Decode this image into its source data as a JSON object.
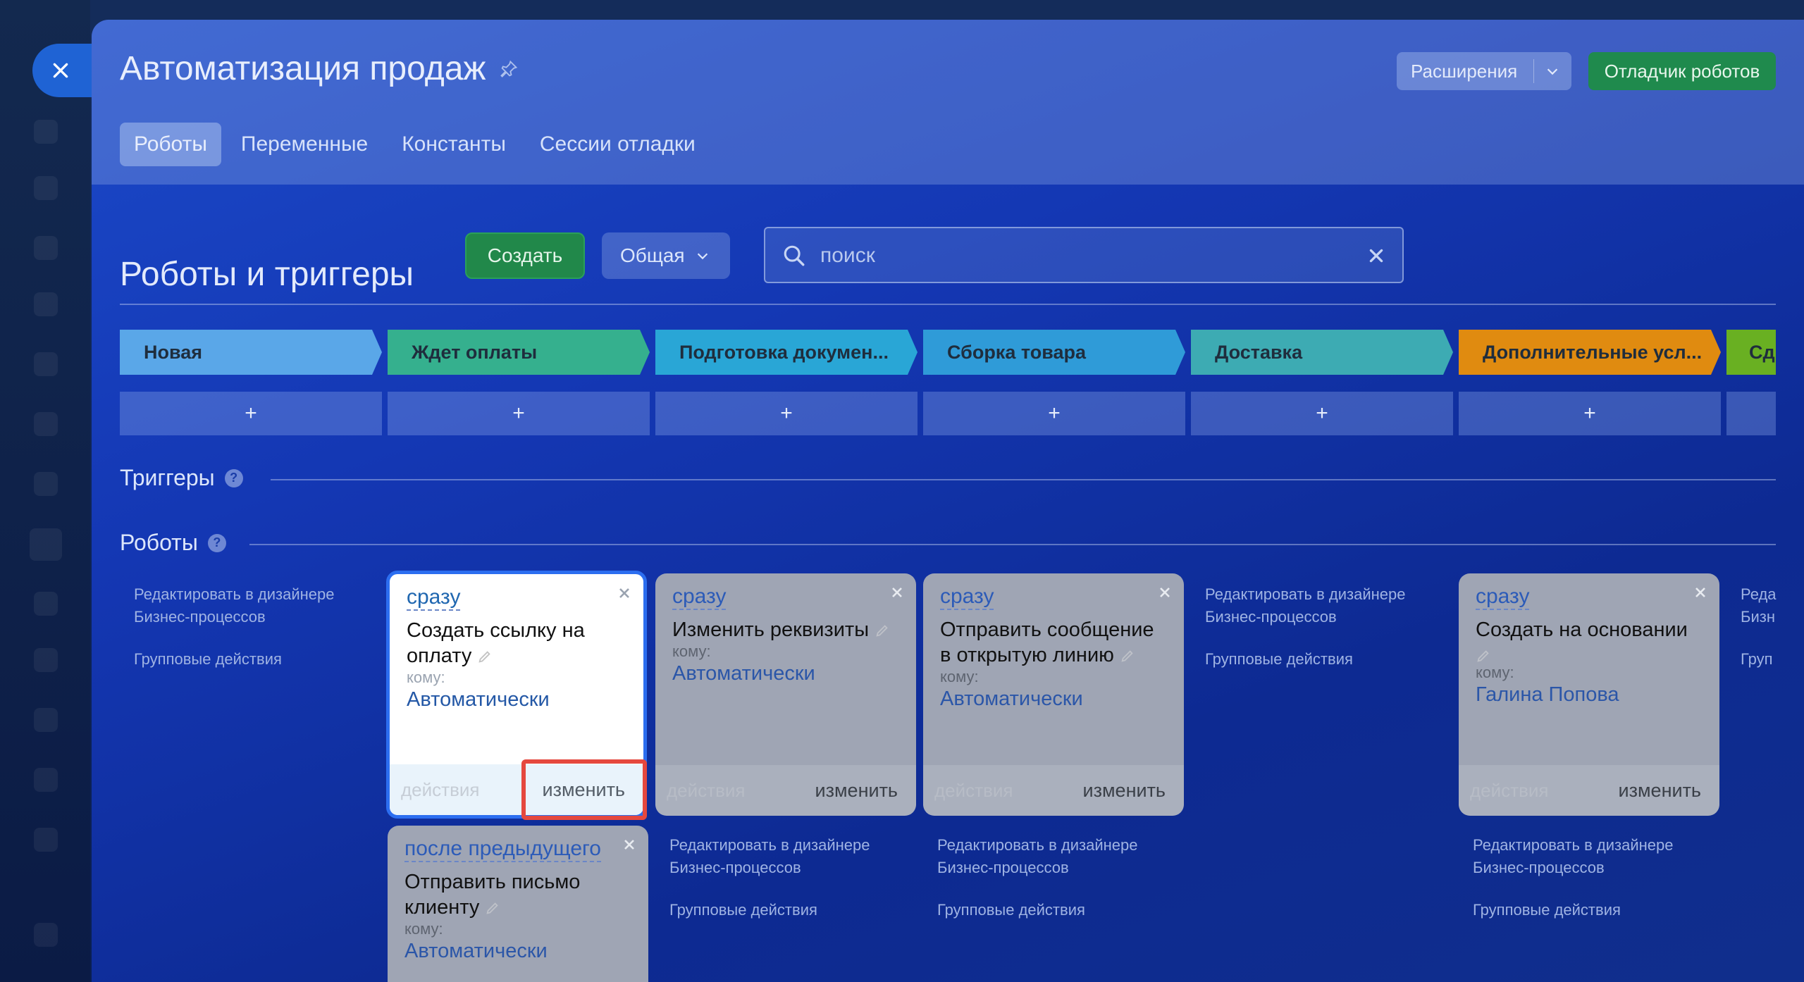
{
  "window": {
    "title": "Автоматизация продаж"
  },
  "header": {
    "extensions_label": "Расширения",
    "debugger_label": "Отладчик роботов",
    "tabs": [
      {
        "label": "Роботы",
        "active": true
      },
      {
        "label": "Переменные",
        "active": false
      },
      {
        "label": "Константы",
        "active": false
      },
      {
        "label": "Сессии отладки",
        "active": false
      }
    ]
  },
  "toolbar": {
    "section_title": "Роботы и триггеры",
    "create_label": "Создать",
    "general_label": "Общая",
    "search_placeholder": "поиск"
  },
  "stages": [
    {
      "label": "Новая",
      "color": "#5aa7e8"
    },
    {
      "label": "Ждет оплаты",
      "color": "#35b08e"
    },
    {
      "label": "Подготовка докумен...",
      "color": "#29a6d6"
    },
    {
      "label": "Сборка товара",
      "color": "#2f9bd8"
    },
    {
      "label": "Доставка",
      "color": "#3dabb3"
    },
    {
      "label": "Дополнительные усл...",
      "color": "#e08b10"
    },
    {
      "label": "Сд",
      "color": "#69b022"
    }
  ],
  "add_label": "+",
  "sections": {
    "triggers": "Триггеры",
    "robots": "Роботы",
    "help": "?"
  },
  "side_links": {
    "edit_designer": "Редактировать в дизайнере Бизнес-процессов",
    "group_actions": "Групповые действия",
    "edit_designer_cut": "Реда Бизн",
    "group_actions_cut": "Груп"
  },
  "cards": [
    {
      "when": "сразу",
      "name": "Создать ссылку на оплату",
      "to_label": "кому:",
      "assignee": "Автоматически",
      "actions": "действия",
      "edit": "изменить"
    },
    {
      "when": "сразу",
      "name": "Изменить реквизиты",
      "to_label": "кому:",
      "assignee": "Автоматически",
      "actions": "действия",
      "edit": "изменить"
    },
    {
      "when": "сразу",
      "name": "Отправить сообщение в открытую линию",
      "to_label": "кому:",
      "assignee": "Автоматически",
      "actions": "действия",
      "edit": "изменить"
    },
    {
      "when": "сразу",
      "name": "Создать на основании",
      "to_label": "кому:",
      "assignee": "Галина Попова",
      "actions": "действия",
      "edit": "изменить"
    },
    {
      "when": "после предыдущего",
      "name": "Отправить письмо клиенту",
      "to_label": "кому:",
      "assignee": "Автоматически"
    }
  ],
  "colors": {
    "accent": "#2c6ef0",
    "create": "#21884a",
    "highlight": "#e5483e"
  }
}
